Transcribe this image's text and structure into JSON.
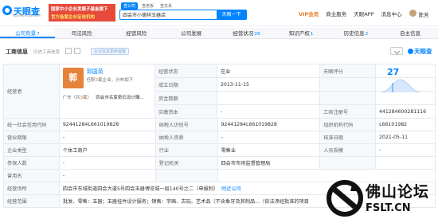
{
  "header": {
    "logo_text": "天眼查",
    "logo_sub": "TianYancha.com",
    "promo_line1": "国家中小企业发展子基金旗下",
    "promo_line2": "官方备案企业征信机构",
    "search_tabs": [
      "查公司",
      "查老板",
      "查关系"
    ],
    "search_value": "四会市小德祥玉器店",
    "search_button": "天眼一下",
    "nav": {
      "vip": "VIP会员",
      "service": "商业服务",
      "app": "天眼APP",
      "messages": "消息中心",
      "user": "陈芳"
    }
  },
  "tabs": [
    {
      "label": "公司背景",
      "count": "7"
    },
    {
      "label": "司法风险",
      "count": ""
    },
    {
      "label": "经营风险",
      "count": ""
    },
    {
      "label": "公司发展",
      "count": ""
    },
    {
      "label": "经营状况",
      "count": "29"
    },
    {
      "label": "知识产权",
      "count": "1"
    },
    {
      "label": "历史信息",
      "count": "2"
    },
    {
      "label": "自主信息",
      "count": ""
    }
  ],
  "section": {
    "title": "工商信息",
    "history_link": "历史工商信息",
    "tag": "企业信息更新提醒",
    "brand": "天眼查"
  },
  "table": {
    "legal_rep_label": "经营者",
    "legal_rep": {
      "avatar_char": "郭",
      "name": "郭国英",
      "sub_prefix": "任职",
      "sub_count": "3",
      "sub_suffix": "家企业，分布如下",
      "loc_prefix": "广东（共",
      "loc_count": "3",
      "loc_suffix": "家）",
      "related": "四会市名家奇石设计雕..."
    },
    "status_label": "经营状态",
    "status": "在业",
    "est_date_label": "成立日期",
    "est_date": "2013-11-15",
    "capital_label": "资金数额",
    "capital": "",
    "paid_label": "实缴资本",
    "paid": "-",
    "score_label": "天眼评分",
    "score_value": "27",
    "reg_no_label": "工商注册号",
    "reg_no": "441284600281116",
    "credit_code_label": "统一社会信用代码",
    "credit_code": "92441284L661019828",
    "tax_id_label": "纳税人识别号",
    "tax_id": "92441284L661019828",
    "org_code_label": "组织机构代码",
    "org_code": "L66101982",
    "term_label": "营业期限",
    "term": "-",
    "taxpayer_label": "纳税人资质",
    "taxpayer": "-",
    "approve_label": "核准日期",
    "approve": "2021-05-11",
    "type_label": "企业类型",
    "type": "个体工商户",
    "industry_label": "行业",
    "industry": "零售业",
    "staff_label": "人员规模",
    "staff": "-",
    "insured_label": "参保人数",
    "insured": "-",
    "authority_label": "登记机关",
    "authority": "四会市市场监督管理局",
    "former_label": "曾用名",
    "former": "-",
    "address_label": "经营场所",
    "address": "四会市东城街道四会大道S号四会玉器博览城一层140号之二（申报制）",
    "address_link": "附近公司",
    "scope_label": "经营范围",
    "scope": "批发、零售：玉器；玉器挂件设计服务；销售：字画、古玩、艺术品（不含象牙及其制品...（依法须经批准的项目"
  },
  "watermark": {
    "title": "佛山论坛",
    "sub": "FSLT.CN"
  }
}
